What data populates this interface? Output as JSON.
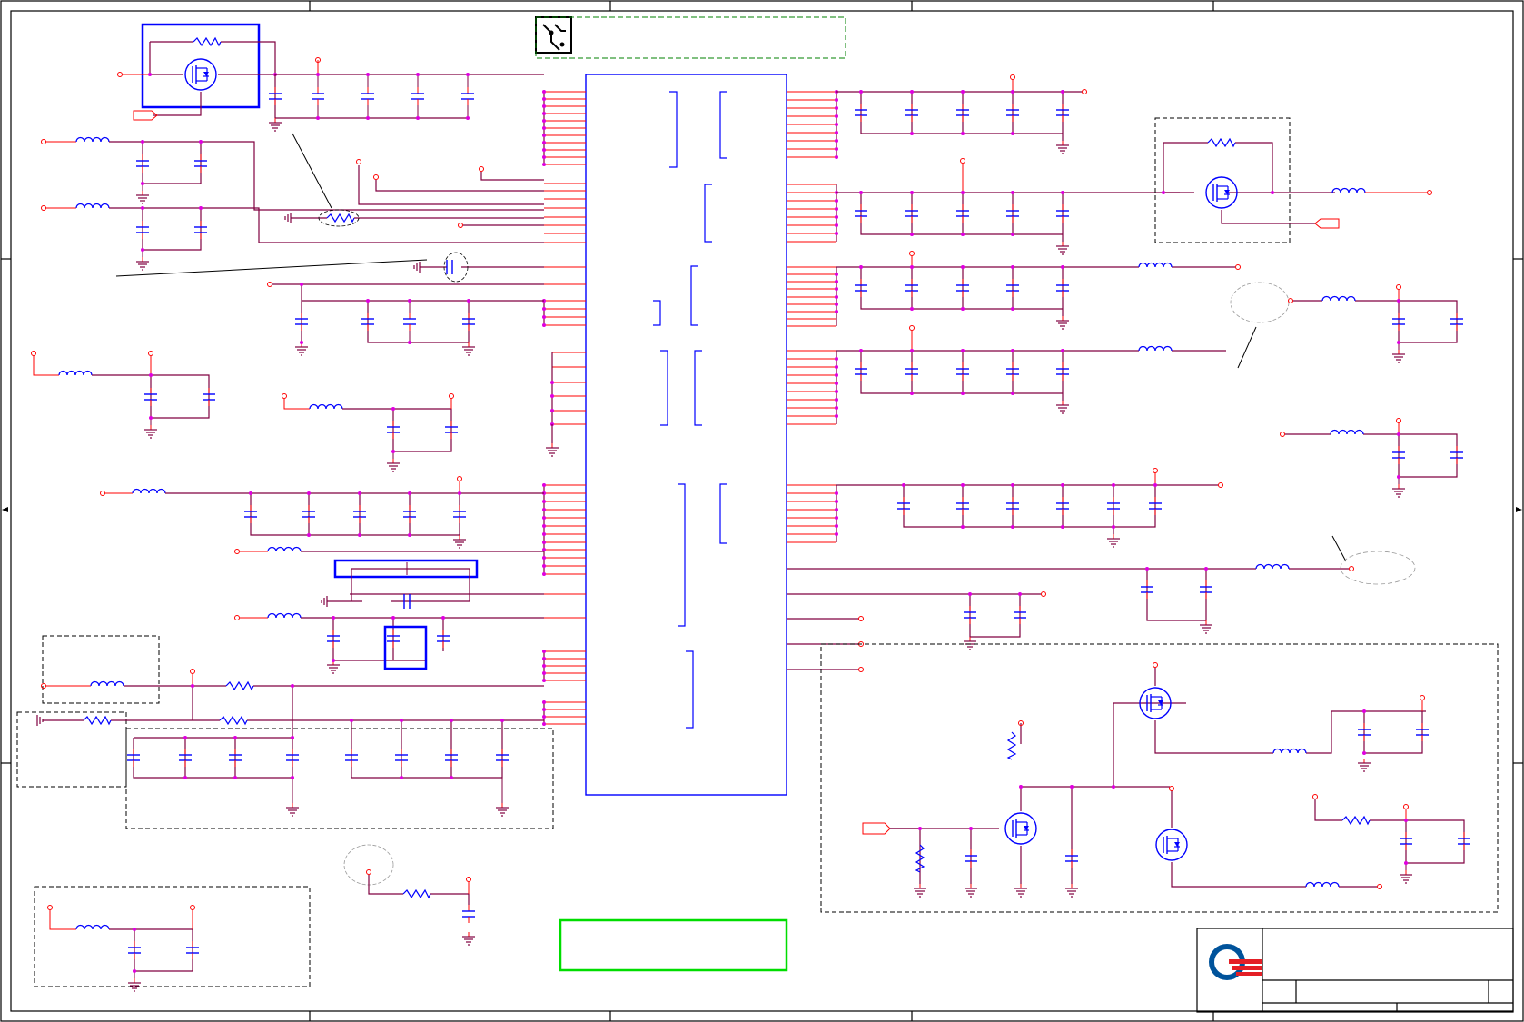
{
  "sheet": {
    "type": "schematic",
    "title_block": {
      "logo": "company-logo"
    },
    "colors": {
      "wire": "#800040",
      "pin": "#ff0000",
      "component": "#0000ff",
      "junction": "#e000e0",
      "border": "#000000",
      "highlight": "#0000ff",
      "note_box": "#00dd00",
      "group_box": "#000000",
      "annotation": "#999999"
    }
  }
}
